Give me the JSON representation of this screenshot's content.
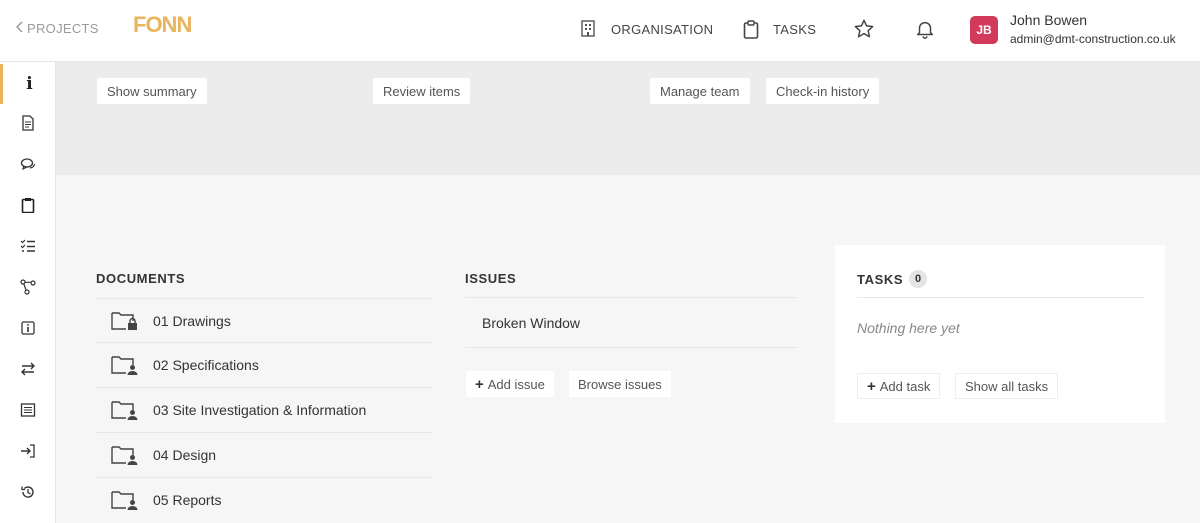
{
  "header": {
    "back_label": "PROJECTS",
    "logo_text": "FONN",
    "nav": [
      {
        "label": "ORGANISATION",
        "icon": "building-icon"
      },
      {
        "label": "TASKS",
        "icon": "clipboard-icon"
      }
    ],
    "user": {
      "initials": "JB",
      "name": "John Bowen",
      "email": "admin@dmt-construction.co.uk",
      "avatar_color": "#d23a5c"
    }
  },
  "sidebar": {
    "accent_color": "#e8b45c",
    "items": [
      {
        "icon": "info-icon",
        "active": true
      },
      {
        "icon": "document-icon"
      },
      {
        "icon": "chat-icon"
      },
      {
        "icon": "clipboard-icon"
      },
      {
        "icon": "checklist-icon"
      },
      {
        "icon": "workflow-icon"
      },
      {
        "icon": "info-box-icon"
      },
      {
        "icon": "transfer-icon"
      },
      {
        "icon": "list-icon"
      },
      {
        "icon": "sign-in-icon"
      },
      {
        "icon": "history-icon"
      }
    ]
  },
  "actions": {
    "show_summary": "Show summary",
    "review_items": "Review items",
    "manage_team": "Manage team",
    "checkin_history": "Check-in history"
  },
  "documents": {
    "title": "DOCUMENTS",
    "folders": [
      {
        "name": "01 Drawings",
        "icon": "folder-lock-icon"
      },
      {
        "name": "02 Specifications",
        "icon": "folder-user-icon"
      },
      {
        "name": "03 Site Investigation & Information",
        "icon": "folder-user-icon"
      },
      {
        "name": "04 Design",
        "icon": "folder-user-icon"
      },
      {
        "name": "05 Reports",
        "icon": "folder-user-icon"
      }
    ]
  },
  "issues": {
    "title": "ISSUES",
    "items": [
      "Broken Window"
    ],
    "add_label": "Add issue",
    "browse_label": "Browse issues"
  },
  "tasks": {
    "title": "TASKS",
    "count": "0",
    "empty_text": "Nothing here yet",
    "add_label": "Add task",
    "show_all_label": "Show all tasks"
  }
}
